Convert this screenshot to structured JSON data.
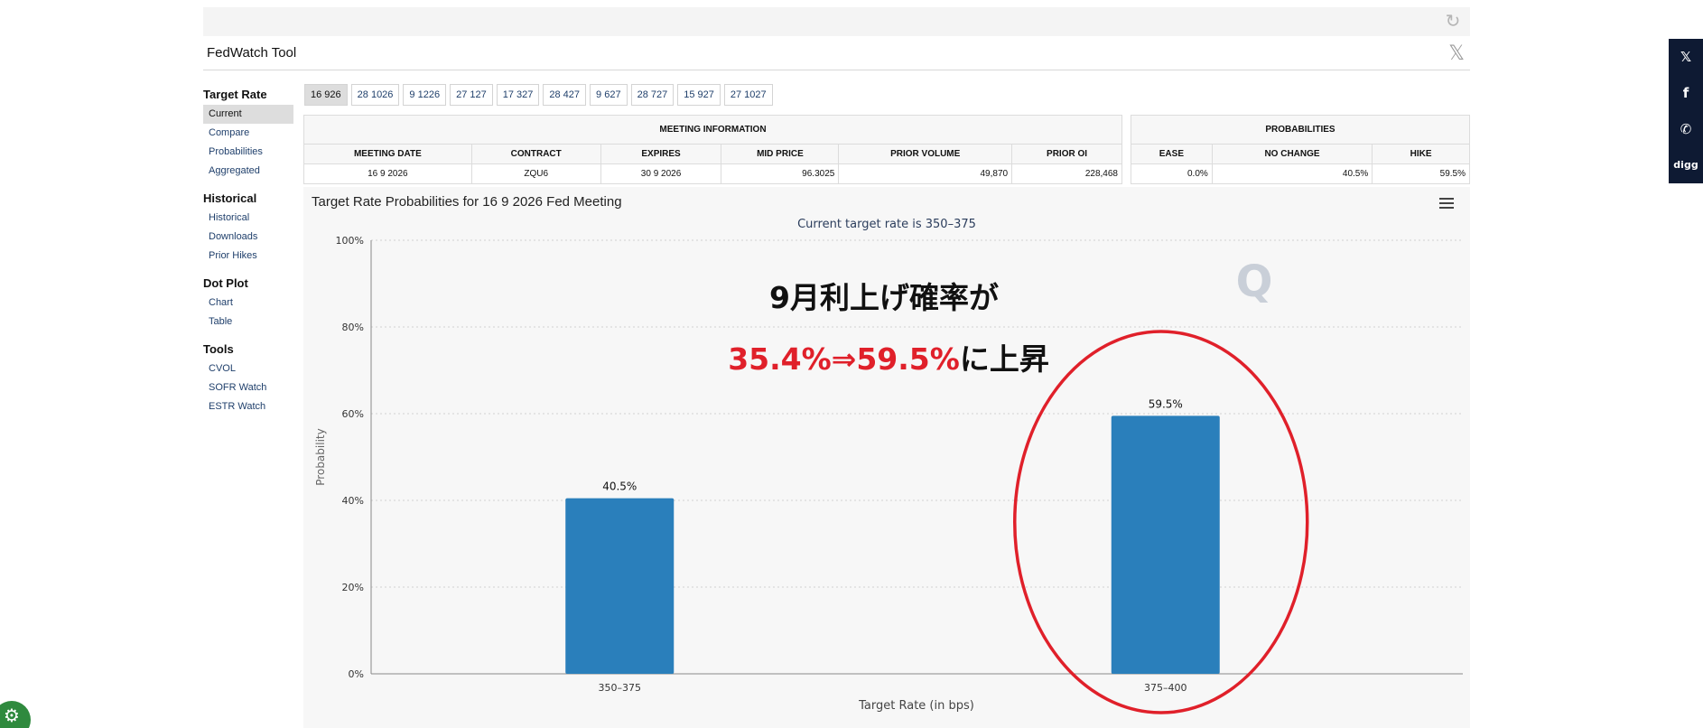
{
  "header": {
    "title": "FedWatch Tool",
    "refresh_icon": "↻",
    "close_icon": "𝕏"
  },
  "sidebar": {
    "sections": [
      {
        "title": "Target Rate",
        "items": [
          "Current",
          "Compare",
          "Probabilities",
          "Aggregated"
        ]
      },
      {
        "title": "Historical",
        "items": [
          "Historical",
          "Downloads",
          "Prior Hikes"
        ]
      },
      {
        "title": "Dot Plot",
        "items": [
          "Chart",
          "Table"
        ]
      },
      {
        "title": "Tools",
        "items": [
          "CVOL",
          "SOFR Watch",
          "ESTR Watch"
        ]
      }
    ],
    "active": "Current"
  },
  "tabs": [
    "16 926",
    "28 1026",
    "9 1226",
    "27 127",
    "17 327",
    "28 427",
    "9 627",
    "28 727",
    "15 927",
    "27 1027"
  ],
  "meeting_info": {
    "title": "MEETING INFORMATION",
    "headers": [
      "MEETING DATE",
      "CONTRACT",
      "EXPIRES",
      "MID PRICE",
      "PRIOR VOLUME",
      "PRIOR OI"
    ],
    "row": [
      "16 9 2026",
      "ZQU6",
      "30 9 2026",
      "96.3025",
      "49,870",
      "228,468"
    ]
  },
  "probabilities": {
    "title": "PROBABILITIES",
    "headers": [
      "EASE",
      "NO CHANGE",
      "HIKE"
    ],
    "row": [
      "0.0%",
      "40.5%",
      "59.5%"
    ]
  },
  "chart": {
    "title": "Target Rate Probabilities for 16 9 2026 Fed Meeting",
    "subtitle": "Current target rate is 350–375",
    "watermark": "Q",
    "annotation_line1": "9月利上げ確率が",
    "annotation_line2_red": "35.4%⇒59.5%",
    "annotation_line2_black": "に上昇"
  },
  "chart_data": {
    "type": "bar",
    "title": "Target Rate Probabilities for 16 9 2026 Fed Meeting",
    "subtitle": "Current target rate is 350–375",
    "categories": [
      "350–375",
      "375–400"
    ],
    "values": [
      40.5,
      59.5
    ],
    "data_labels": [
      "40.5%",
      "59.5%"
    ],
    "xlabel": "Target Rate (in bps)",
    "ylabel": "Probability",
    "ylim": [
      0,
      100
    ],
    "yticks": [
      "0%",
      "20%",
      "40%",
      "60%",
      "80%",
      "100%"
    ],
    "grid": true,
    "bar_color": "#2a7fbb",
    "highlight_color": "#e0202a",
    "highlight_category": "375–400"
  },
  "social": [
    "𝕏",
    "f",
    "✆",
    "digg"
  ],
  "cookie_icon": "⚙"
}
